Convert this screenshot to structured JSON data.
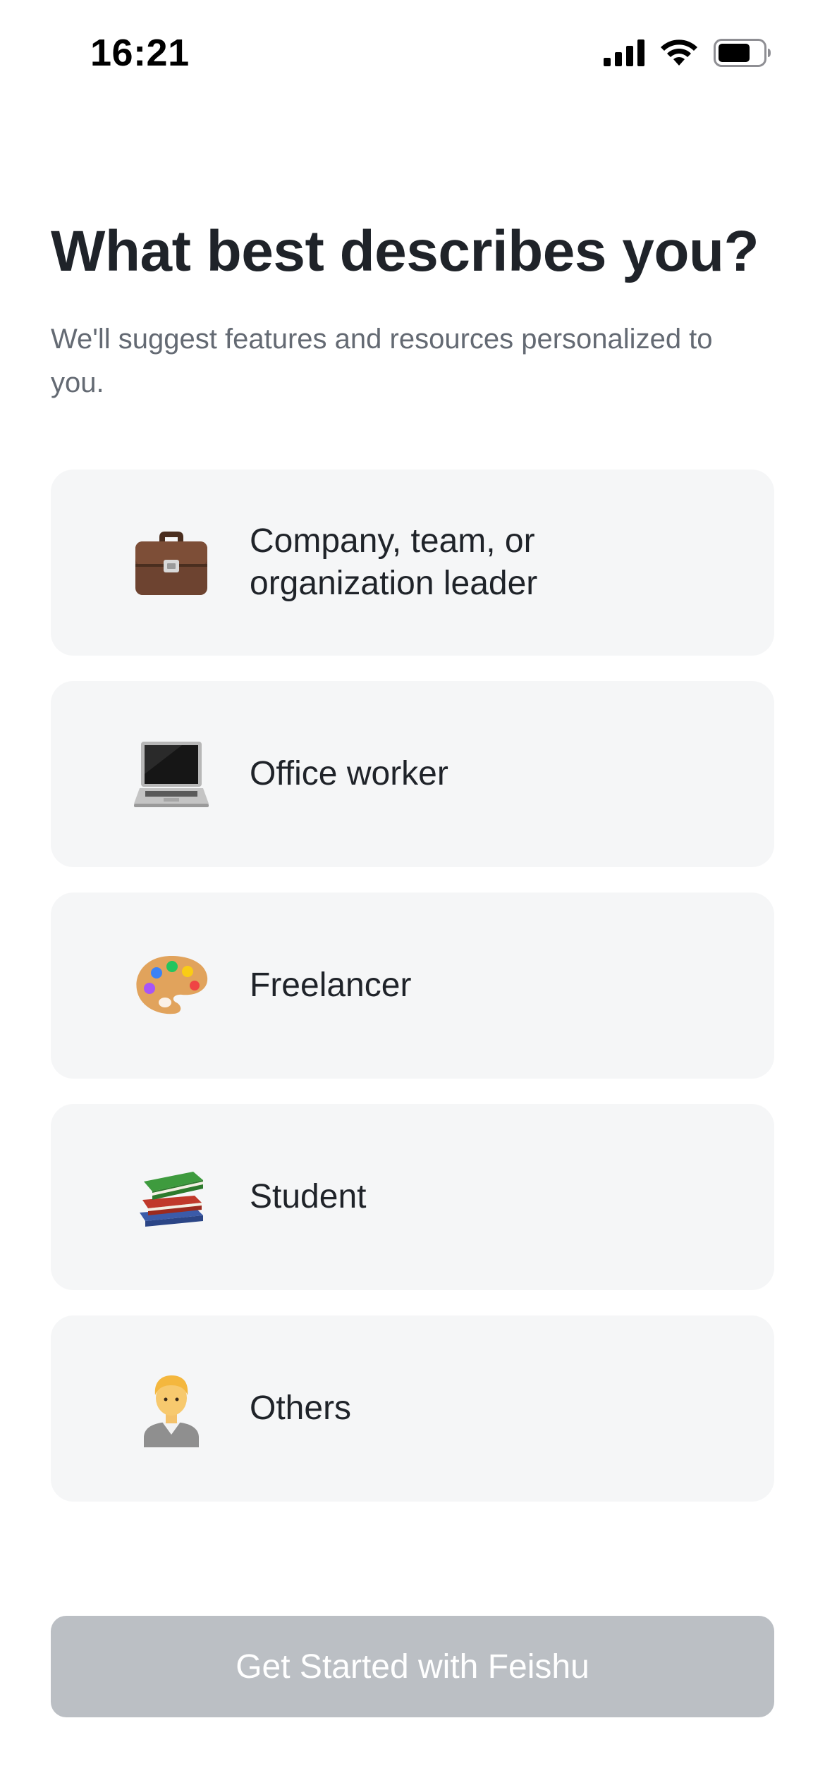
{
  "status_bar": {
    "time": "16:21",
    "icons": [
      "cellular-signal-icon",
      "wifi-icon",
      "battery-icon"
    ]
  },
  "header": {
    "title": "What best describes you?",
    "subtitle": "We'll suggest features and resources personalized to you."
  },
  "options": [
    {
      "icon": "briefcase-icon",
      "label": "Company, team, or\norganization leader"
    },
    {
      "icon": "laptop-icon",
      "label": "Office worker"
    },
    {
      "icon": "artist-palette-icon",
      "label": "Freelancer"
    },
    {
      "icon": "books-icon",
      "label": "Student"
    },
    {
      "icon": "person-icon",
      "label": "Others"
    }
  ],
  "cta": {
    "label": "Get Started with Feishu",
    "state": "disabled"
  },
  "colors": {
    "card_bg": "#f5f6f7",
    "title": "#1f2329",
    "subtitle": "#646a73",
    "cta_disabled": "#bbbfc4"
  }
}
